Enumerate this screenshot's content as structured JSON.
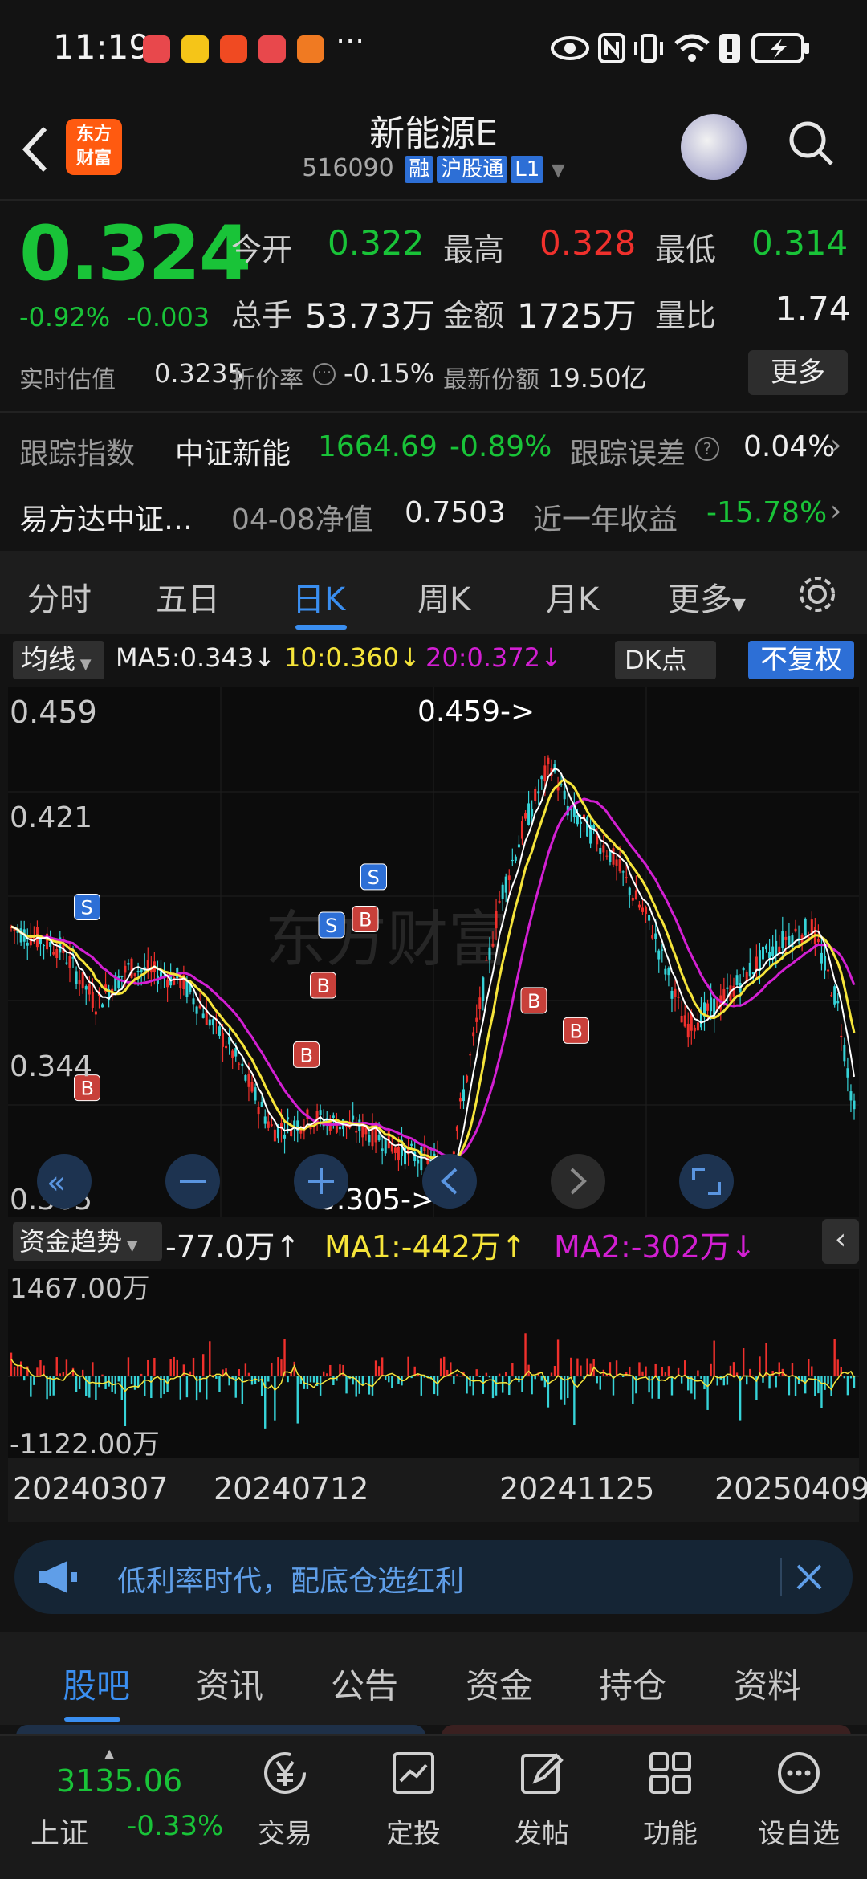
{
  "status": {
    "time": "11:19"
  },
  "header": {
    "logo_line1": "东方",
    "logo_line2": "财富",
    "title": "新能源E",
    "code": "516090",
    "tags": [
      "融",
      "沪股通",
      "L1"
    ]
  },
  "quote": {
    "price": "0.324",
    "change_pct": "-0.92%",
    "change": "-0.003",
    "open_label": "今开",
    "open": "0.322",
    "high_label": "最高",
    "high": "0.328",
    "low_label": "最低",
    "low": "0.314",
    "volume_label": "总手",
    "volume": "53.73万",
    "amount_label": "金额",
    "amount": "1725万",
    "ratio_label": "量比",
    "ratio": "1.74",
    "est_label": "实时估值",
    "est": "0.3235",
    "discount_label": "折价率",
    "discount": "-0.15%",
    "shares_label": "最新份额",
    "shares": "19.50亿",
    "more": "更多"
  },
  "tracking": {
    "label": "跟踪指数",
    "index": "中证新能",
    "value": "1664.69",
    "pct": "-0.89%",
    "err_label": "跟踪误差",
    "err": "0.04%"
  },
  "fund": {
    "name": "易方达中证…",
    "nav_label": "04-08净值",
    "nav": "0.7503",
    "ret_label": "近一年收益",
    "ret": "-15.78%"
  },
  "tabs": [
    "分时",
    "五日",
    "日K",
    "周K",
    "月K",
    "更多"
  ],
  "chart_toolbar": {
    "ma_button": "均线",
    "ma5": "MA5:0.343↓",
    "ma10": "10:0.360↓",
    "ma20": "20:0.372↓",
    "dk_button": "DK点",
    "fq_button": "不复权"
  },
  "kchart_labels": {
    "y_top": "0.459",
    "y_2": "0.421",
    "y_3": "0.344",
    "y_bottom": "0.305",
    "max_tag": "0.459->",
    "min_tag": "0.305->",
    "watermark": "东方财富"
  },
  "fund_flow": {
    "button": "资金趋势",
    "value": "-77.0万↑",
    "ma1": "MA1:-442万↑",
    "ma2": "MA2:-302万↓",
    "y_top": "1467.00万",
    "y_bottom": "-1122.00万"
  },
  "dates": [
    "20240307",
    "20240712",
    "20241125",
    "20250409"
  ],
  "banner": {
    "text": "低利率时代，配底仓选红利"
  },
  "bottom_tabs": [
    "股吧",
    "资讯",
    "公告",
    "资金",
    "持仓",
    "资料"
  ],
  "nav": {
    "index_value": "3135.06",
    "index_name": "上证",
    "index_pct": "-0.33%",
    "items": [
      "交易",
      "定投",
      "发帖",
      "功能",
      "设自选"
    ]
  },
  "colors": {
    "up": "#f0302c",
    "down": "#19c338",
    "accent": "#3a8ef0",
    "ma5": "#ffffff",
    "ma10": "#f5e43a",
    "ma20": "#d21fd2",
    "candle_down": "#36d3d8"
  }
}
